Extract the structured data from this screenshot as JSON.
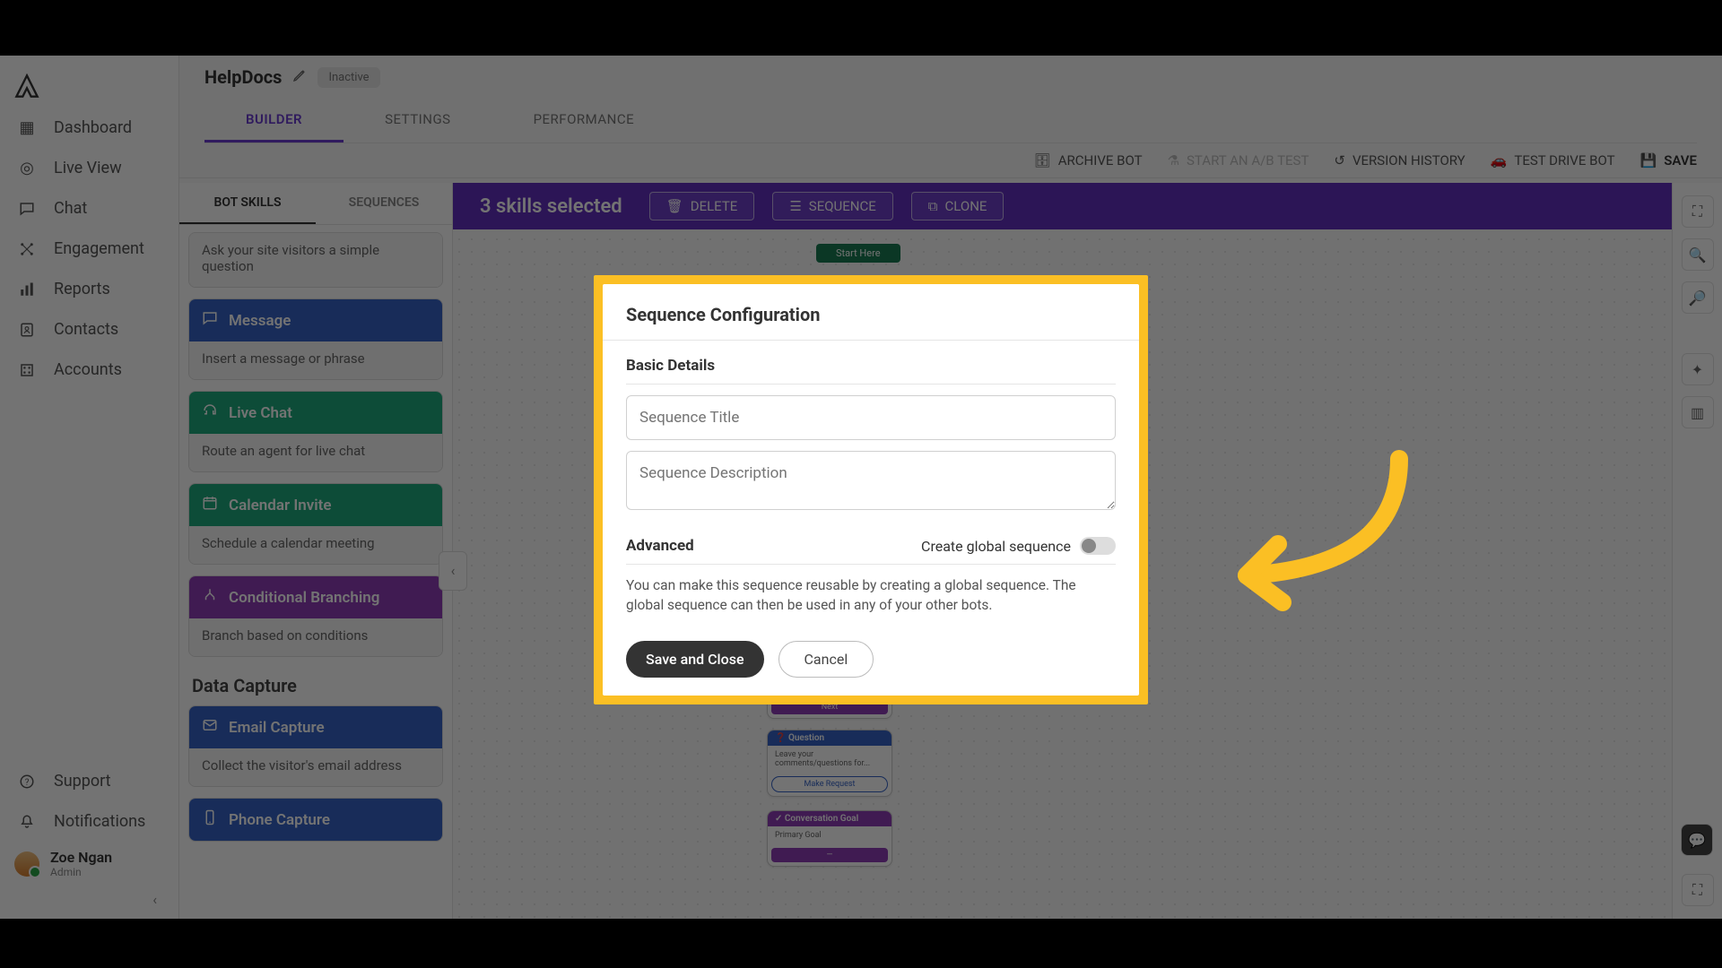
{
  "sidebar": {
    "items": [
      {
        "label": "Dashboard"
      },
      {
        "label": "Live View"
      },
      {
        "label": "Chat"
      },
      {
        "label": "Engagement"
      },
      {
        "label": "Reports"
      },
      {
        "label": "Contacts"
      },
      {
        "label": "Accounts"
      }
    ],
    "bottom": [
      {
        "label": "Support"
      },
      {
        "label": "Notifications"
      }
    ],
    "user": {
      "name": "Zoe Ngan",
      "role": "Admin"
    }
  },
  "header": {
    "botName": "HelpDocs",
    "statusPill": "Inactive",
    "tabs": {
      "builder": "BUILDER",
      "settings": "SETTINGS",
      "performance": "PERFORMANCE"
    }
  },
  "toolbar": {
    "archive": "ARCHIVE BOT",
    "ab": "START AN A/B TEST",
    "version": "VERSION HISTORY",
    "testdrive": "TEST DRIVE BOT",
    "save": "SAVE"
  },
  "skillsPanel": {
    "tabs": {
      "skills": "BOT SKILLS",
      "sequences": "SEQUENCES"
    },
    "question": {
      "title": "",
      "desc": "Ask your site visitors a simple question"
    },
    "message": {
      "title": "Message",
      "desc": "Insert a message or phrase"
    },
    "livechat": {
      "title": "Live Chat",
      "desc": "Route an agent for live chat"
    },
    "calendar": {
      "title": "Calendar Invite",
      "desc": "Schedule a calendar meeting"
    },
    "branching": {
      "title": "Conditional Branching",
      "desc": "Branch based on conditions"
    },
    "section": "Data Capture",
    "email": {
      "title": "Email Capture",
      "desc": "Collect the visitor's email address"
    },
    "phone": {
      "title": "Phone Capture"
    }
  },
  "selectionBar": {
    "text": "3 skills selected",
    "delete": "DELETE",
    "sequence": "SEQUENCE",
    "clone": "CLONE"
  },
  "canvas": {
    "startHere": "Start Here",
    "questionNode": {
      "head": "Question",
      "body": "Leave your comments/questions for...",
      "pill": "Make Request"
    },
    "goalNode": {
      "head": "Conversation Goal",
      "body": "Primary Goal",
      "foot": "—"
    },
    "nextLabel": "Next"
  },
  "modal": {
    "title": "Sequence Configuration",
    "basic": "Basic Details",
    "titlePH": "Sequence Title",
    "descPH": "Sequence Description",
    "advanced": "Advanced",
    "toggleLabel": "Create global sequence",
    "helper": "You can make this sequence reusable by creating a global sequence. The global sequence can then be used in any of your other bots.",
    "save": "Save and Close",
    "cancel": "Cancel"
  }
}
